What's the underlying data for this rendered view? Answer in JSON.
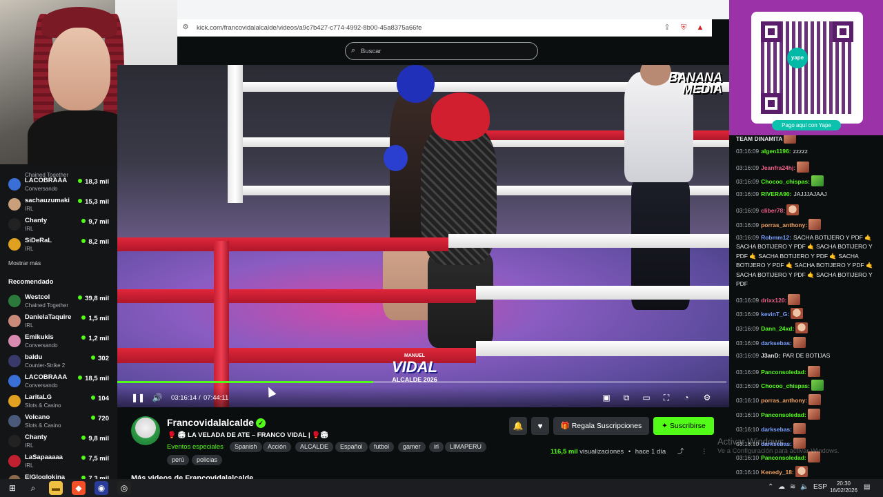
{
  "browser": {
    "url": "kick.com/francovidalalcalde/videos/a9c7b427-c774-4992-8b00-45a8375a66fe"
  },
  "header": {
    "search_placeholder": "Buscar"
  },
  "overlay": {
    "qr_caption": "Pago aquí con Yape",
    "qr_logo": "yape",
    "video_logo_line1": "BANANA",
    "video_logo_line2": "MEDIA",
    "scoreboard_top": "MANUEL",
    "scoreboard_name": "VIDAL",
    "scoreboard_bottom": "ALCALDE 2026"
  },
  "sidebar": {
    "top_items": [
      {
        "name": "",
        "sub": "Chained Together",
        "count": ""
      },
      {
        "name": "LACOBRAAA",
        "sub": "Conversando",
        "count": "18,3 mil",
        "color": "#3b6fd8"
      },
      {
        "name": "sachauzumaki",
        "sub": "IRL",
        "count": "15,3 mil",
        "color": "#c9a07a"
      },
      {
        "name": "Chanty",
        "sub": "IRL",
        "count": "9,7 mil",
        "color": "#222"
      },
      {
        "name": "SiDeRaL",
        "sub": "IRL",
        "count": "8,2 mil",
        "color": "#e0a020"
      }
    ],
    "show_more": "Mostrar más",
    "recommended_heading": "Recomendado",
    "recommended": [
      {
        "name": "Westcol",
        "sub": "Chained Together",
        "count": "39,8 mil",
        "color": "#2b7a3b"
      },
      {
        "name": "DanielaTaquire",
        "sub": "IRL",
        "count": "1,5 mil",
        "color": "#c98a7a"
      },
      {
        "name": "Emikukis",
        "sub": "Conversando",
        "count": "1,2 mil",
        "color": "#d88ab0"
      },
      {
        "name": "baldu",
        "sub": "Counter-Strike 2",
        "count": "302",
        "color": "#3a3a6a"
      },
      {
        "name": "LACOBRAAA",
        "sub": "Conversando",
        "count": "18,5 mil",
        "color": "#3b6fd8"
      },
      {
        "name": "LaritaLG",
        "sub": "Slots & Casino",
        "count": "104",
        "color": "#e0a020"
      },
      {
        "name": "Volcano",
        "sub": "Slots & Casino",
        "count": "720",
        "color": "#4a5a7a"
      },
      {
        "name": "Chanty",
        "sub": "IRL",
        "count": "9,8 mil",
        "color": "#222"
      },
      {
        "name": "LaSapaaaaa",
        "sub": "IRL",
        "count": "7,5 mil",
        "color": "#c02030"
      },
      {
        "name": "ElGloglokina",
        "sub": "",
        "count": "7,3 mil",
        "color": "#8a6a4a"
      }
    ]
  },
  "player": {
    "progress": 0.42,
    "time_current": "03:16:14",
    "time_sep": "/",
    "time_total": "07:44:11"
  },
  "channel": {
    "name": "Francovidalalcalde",
    "title": "🥊 🏟 LA VELADA DE ATE – FRANCO VIDAL | 🥊🏟",
    "category": "Eventos especiales",
    "tags": [
      "Spanish",
      "Acción",
      "ALCALDE",
      "Español",
      "futbol",
      "gamer",
      "irl",
      "LIMAPERU",
      "perú",
      "policias"
    ],
    "gift_label": "Regala Suscripciones",
    "subscribe_label": "Suscribirse",
    "views_count": "116,5 mil",
    "views_label": "visualizaciones",
    "views_sep": "•",
    "time_ago": "hace 1 día",
    "more_videos": "Más videos de Francovidalalcalde"
  },
  "chat": {
    "messages": [
      {
        "time": "",
        "user": "TEAM DINAMITA",
        "color": "#e8e8e8",
        "text": "",
        "emote": "red"
      },
      {
        "time": "03:16:09",
        "user": "algen1196:",
        "color": "#53fc18",
        "text": "zzzzz",
        "emote": ""
      },
      {
        "time": "03:16:09",
        "user": "Jeanfra24hj:",
        "color": "#f0608a",
        "text": "",
        "emote": "red"
      },
      {
        "time": "03:16:09",
        "user": "Chocoo_chispas:",
        "color": "#53fc18",
        "text": "",
        "emote": "green"
      },
      {
        "time": "03:16:09",
        "user": "RIVERA90:",
        "color": "#53fc18",
        "text": "JAJJJAJAAJ",
        "emote": ""
      },
      {
        "time": "03:16:09",
        "user": "cliber78:",
        "color": "#f0608a",
        "text": "",
        "emote": "face"
      },
      {
        "time": "03:16:09",
        "user": "porras_anthony:",
        "color": "#f0a060",
        "text": "",
        "emote": "red"
      },
      {
        "time": "03:16:09",
        "user": "Robmm12:",
        "color": "#7aa0ff",
        "text": "SACHA BOTIJERO Y PDF 🤙 SACHA BOTIJERO Y PDF 🤙 SACHA BOTIJERO Y PDF 🤙 SACHA BOTIJERO Y PDF 🤙 SACHA BOTIJERO Y PDF 🤙 SACHA BOTIJERO Y PDF 🤙 SACHA BOTIJERO Y PDF 🤙 SACHA BOTIJERO Y PDF",
        "emote": ""
      },
      {
        "time": "03:16:09",
        "user": "drixx120:",
        "color": "#f0608a",
        "text": "",
        "emote": "red"
      },
      {
        "time": "03:16:09",
        "user": "kevinT_G:",
        "color": "#7aa0ff",
        "text": "",
        "emote": "face"
      },
      {
        "time": "03:16:09",
        "user": "Dann_24xd:",
        "color": "#53fc18",
        "text": "",
        "emote": "face"
      },
      {
        "time": "03:16:09",
        "user": "darksebas:",
        "color": "#7aa0ff",
        "text": "",
        "emote": "red"
      },
      {
        "time": "03:16:09",
        "user": "J3anD:",
        "color": "#e8e8e8",
        "text": "PAR DE BOTIJAS",
        "emote": ""
      },
      {
        "time": "03:16:09",
        "user": "Panconsoledad:",
        "color": "#53fc18",
        "text": "",
        "emote": "red"
      },
      {
        "time": "03:16:09",
        "user": "Chocoo_chispas:",
        "color": "#53fc18",
        "text": "",
        "emote": "green"
      },
      {
        "time": "03:16:10",
        "user": "porras_anthony:",
        "color": "#f0a060",
        "text": "",
        "emote": "red"
      },
      {
        "time": "03:16:10",
        "user": "Panconsoledad:",
        "color": "#53fc18",
        "text": "",
        "emote": "red"
      },
      {
        "time": "03:16:10",
        "user": "darksebas:",
        "color": "#7aa0ff",
        "text": "",
        "emote": "red"
      },
      {
        "time": "03:16:10",
        "user": "darksebas:",
        "color": "#7aa0ff",
        "text": "",
        "emote": "red"
      },
      {
        "time": "03:16:10",
        "user": "Panconsoledad:",
        "color": "#53fc18",
        "text": "",
        "emote": "red"
      },
      {
        "time": "03:16:10",
        "user": "Kenedy_18:",
        "color": "#f0a060",
        "text": "",
        "emote": "face"
      }
    ]
  },
  "windows": {
    "activate_title": "Activar Windows",
    "activate_sub": "Ve a Configuración para activar Windows.",
    "lang": "ESP",
    "time": "20:30",
    "date": "16/02/2026"
  },
  "colors": {
    "accent": "#53fc18",
    "background": "#0b0e0f",
    "panel": "#2f3337",
    "yape": "#9b32a8"
  }
}
